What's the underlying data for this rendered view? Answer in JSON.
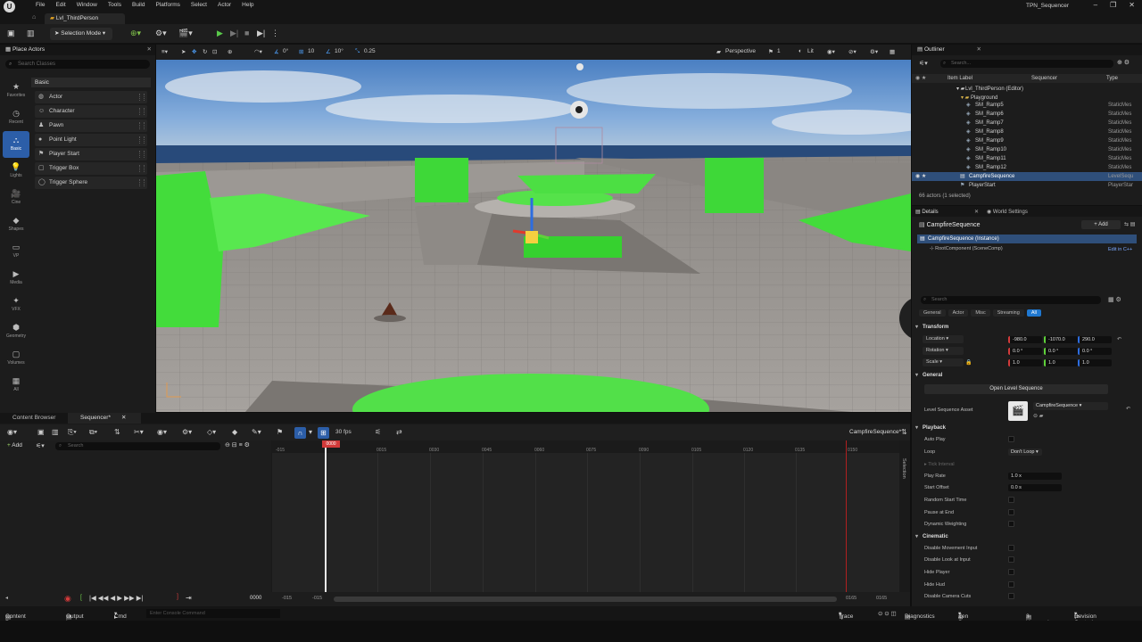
{
  "menubar": {
    "logo": "U",
    "items": [
      "File",
      "Edit",
      "Window",
      "Tools",
      "Build",
      "Platforms",
      "Select",
      "Actor",
      "Help"
    ],
    "project": "TPN_Sequencer",
    "window_buttons": [
      "–",
      "❐",
      "✕"
    ]
  },
  "level_tab": "Lvl_ThirdPerson",
  "toolbar": {
    "selection_mode": "Selection Mode",
    "play_icon": "play-icon"
  },
  "place_actors": {
    "title": "Place Actors",
    "search_placeholder": "Search Classes",
    "categories": [
      "Favorites",
      "Recent",
      "Basic",
      "Lights",
      "Cine",
      "Shapes",
      "VP",
      "Media",
      "VFX",
      "Geometry",
      "Volumes",
      "All"
    ],
    "active_category": "Basic",
    "list_header": "Basic",
    "actors": [
      "Actor",
      "Character",
      "Pawn",
      "Point Light",
      "Player Start",
      "Trigger Box",
      "Trigger Sphere"
    ]
  },
  "viewport": {
    "perspective": "Perspective",
    "lit": "Lit",
    "snap_translate": "10",
    "snap_rotate": "10°",
    "snap_scale": "0.25",
    "rot_value": "0°",
    "cam_speed": "1",
    "camera_count": "1"
  },
  "bottom_tabs": {
    "content_browser": "Content Browser",
    "sequencer": "Sequencer*"
  },
  "sequencer": {
    "add_label": "Add",
    "search_placeholder": "Search",
    "fps": "30 fps",
    "sequence_name": "CampfireSequence*",
    "current_frame": "0000",
    "playhead_label": "0000",
    "ticks": [
      "-015",
      "0015",
      "0030",
      "0045",
      "0060",
      "0075",
      "0090",
      "0105",
      "0120",
      "0135",
      "0150"
    ],
    "range_start": "-015",
    "range_start2": "-015",
    "range_end": "0165",
    "range_end2": "0165",
    "selection_tab": "Selection"
  },
  "outliner": {
    "title": "Outliner",
    "search_placeholder": "Search...",
    "col_label": "Item Label",
    "col_sequencer": "Sequencer",
    "col_type": "Type",
    "level_row": "Lvl_ThirdPerson (Editor)",
    "folder_row": "Playground",
    "rows": [
      {
        "label": "SM_Ramp5",
        "type": "StaticMes"
      },
      {
        "label": "SM_Ramp6",
        "type": "StaticMes"
      },
      {
        "label": "SM_Ramp7",
        "type": "StaticMes"
      },
      {
        "label": "SM_Ramp8",
        "type": "StaticMes"
      },
      {
        "label": "SM_Ramp9",
        "type": "StaticMes"
      },
      {
        "label": "SM_Ramp10",
        "type": "StaticMes"
      },
      {
        "label": "SM_Ramp11",
        "type": "StaticMes"
      },
      {
        "label": "SM_Ramp12",
        "type": "StaticMes"
      },
      {
        "label": "CampfireSequence",
        "type": "LevelSequ"
      },
      {
        "label": "PlayerStart",
        "type": "PlayerStar"
      }
    ],
    "count": "66 actors (1 selected)"
  },
  "details": {
    "tab_details": "Details",
    "tab_world": "World Settings",
    "actor_name": "CampfireSequence",
    "add_button": "+ Add",
    "instance_row": "CampfireSequence (Instance)",
    "root_component": "RootComponent (SceneComp)",
    "edit_cpp": "Edit in C++",
    "search_placeholder": "Search",
    "filters": [
      "General",
      "Actor",
      "Misc",
      "Streaming",
      "All"
    ],
    "active_filter": "All",
    "transform": {
      "section": "Transform",
      "location_label": "Location",
      "rotation_label": "Rotation",
      "scale_label": "Scale",
      "location": [
        "-980.0",
        "-1070.0",
        "290.0"
      ],
      "rotation": [
        "0.0 °",
        "0.0 °",
        "0.0 °"
      ],
      "scale": [
        "1.0",
        "1.0",
        "1.0"
      ]
    },
    "general": {
      "section": "General",
      "open_button": "Open Level Sequence",
      "asset_label": "Level Sequence Asset",
      "asset_value": "CampfireSequence"
    },
    "playback": {
      "section": "Playback",
      "auto_play": "Auto Play",
      "loop": "Loop",
      "loop_value": "Don't Loop",
      "tick_interval": "Tick Interval",
      "play_rate": "Play Rate",
      "play_rate_value": "1.0 x",
      "start_offset": "Start Offset",
      "start_offset_value": "0.0 s",
      "random_start": "Random Start Time",
      "pause_end": "Pause at End",
      "dynamic_weighting": "Dynamic Weighting"
    },
    "cinematic": {
      "section": "Cinematic",
      "disable_movement": "Disable Movement Input",
      "disable_look": "Disable Look at Input",
      "hide_player": "Hide Player",
      "hide_hud": "Hide Hud",
      "disable_cuts": "Disable Camera Cuts"
    }
  },
  "statusbar": {
    "content_drawer": "Content Drawer",
    "output_log": "Output Log",
    "cmd": "Cmd",
    "console_placeholder": "Enter Console Command",
    "trace": "Trace",
    "diagnostics": "Diagnostics",
    "zen": "Zen Server",
    "unsaved": "3 Unsaved",
    "revision": "Revision Control"
  }
}
